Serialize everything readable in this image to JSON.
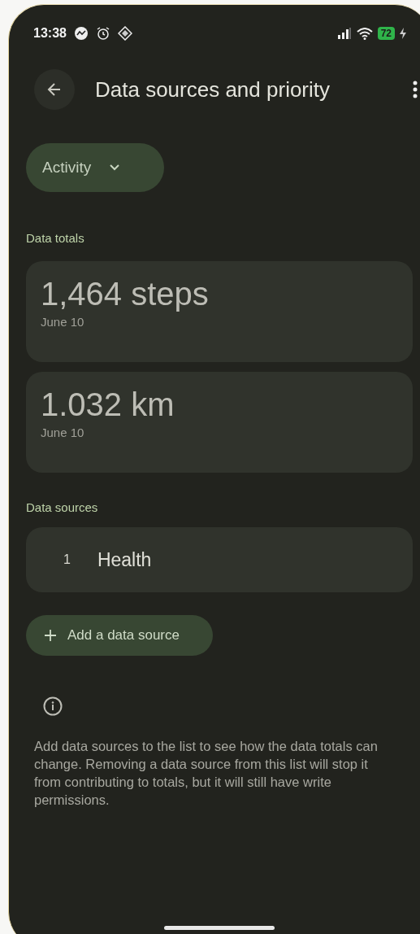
{
  "status_bar": {
    "time": "13:38",
    "battery": "72"
  },
  "header": {
    "title": "Data sources and priority"
  },
  "category_dropdown": {
    "label": "Activity"
  },
  "totals_heading": "Data totals",
  "totals": [
    {
      "value": "1,464 steps",
      "date": "June 10"
    },
    {
      "value": "1.032 km",
      "date": "June 10"
    }
  ],
  "sources_heading": "Data sources",
  "sources": [
    {
      "rank": "1",
      "name": "Health"
    }
  ],
  "add_button": {
    "label": "Add a data source"
  },
  "info_text": "Add data sources to the list to see how the data totals can change. Removing a data source from this list will stop it from contributing to totals, but it will still have write permissions."
}
